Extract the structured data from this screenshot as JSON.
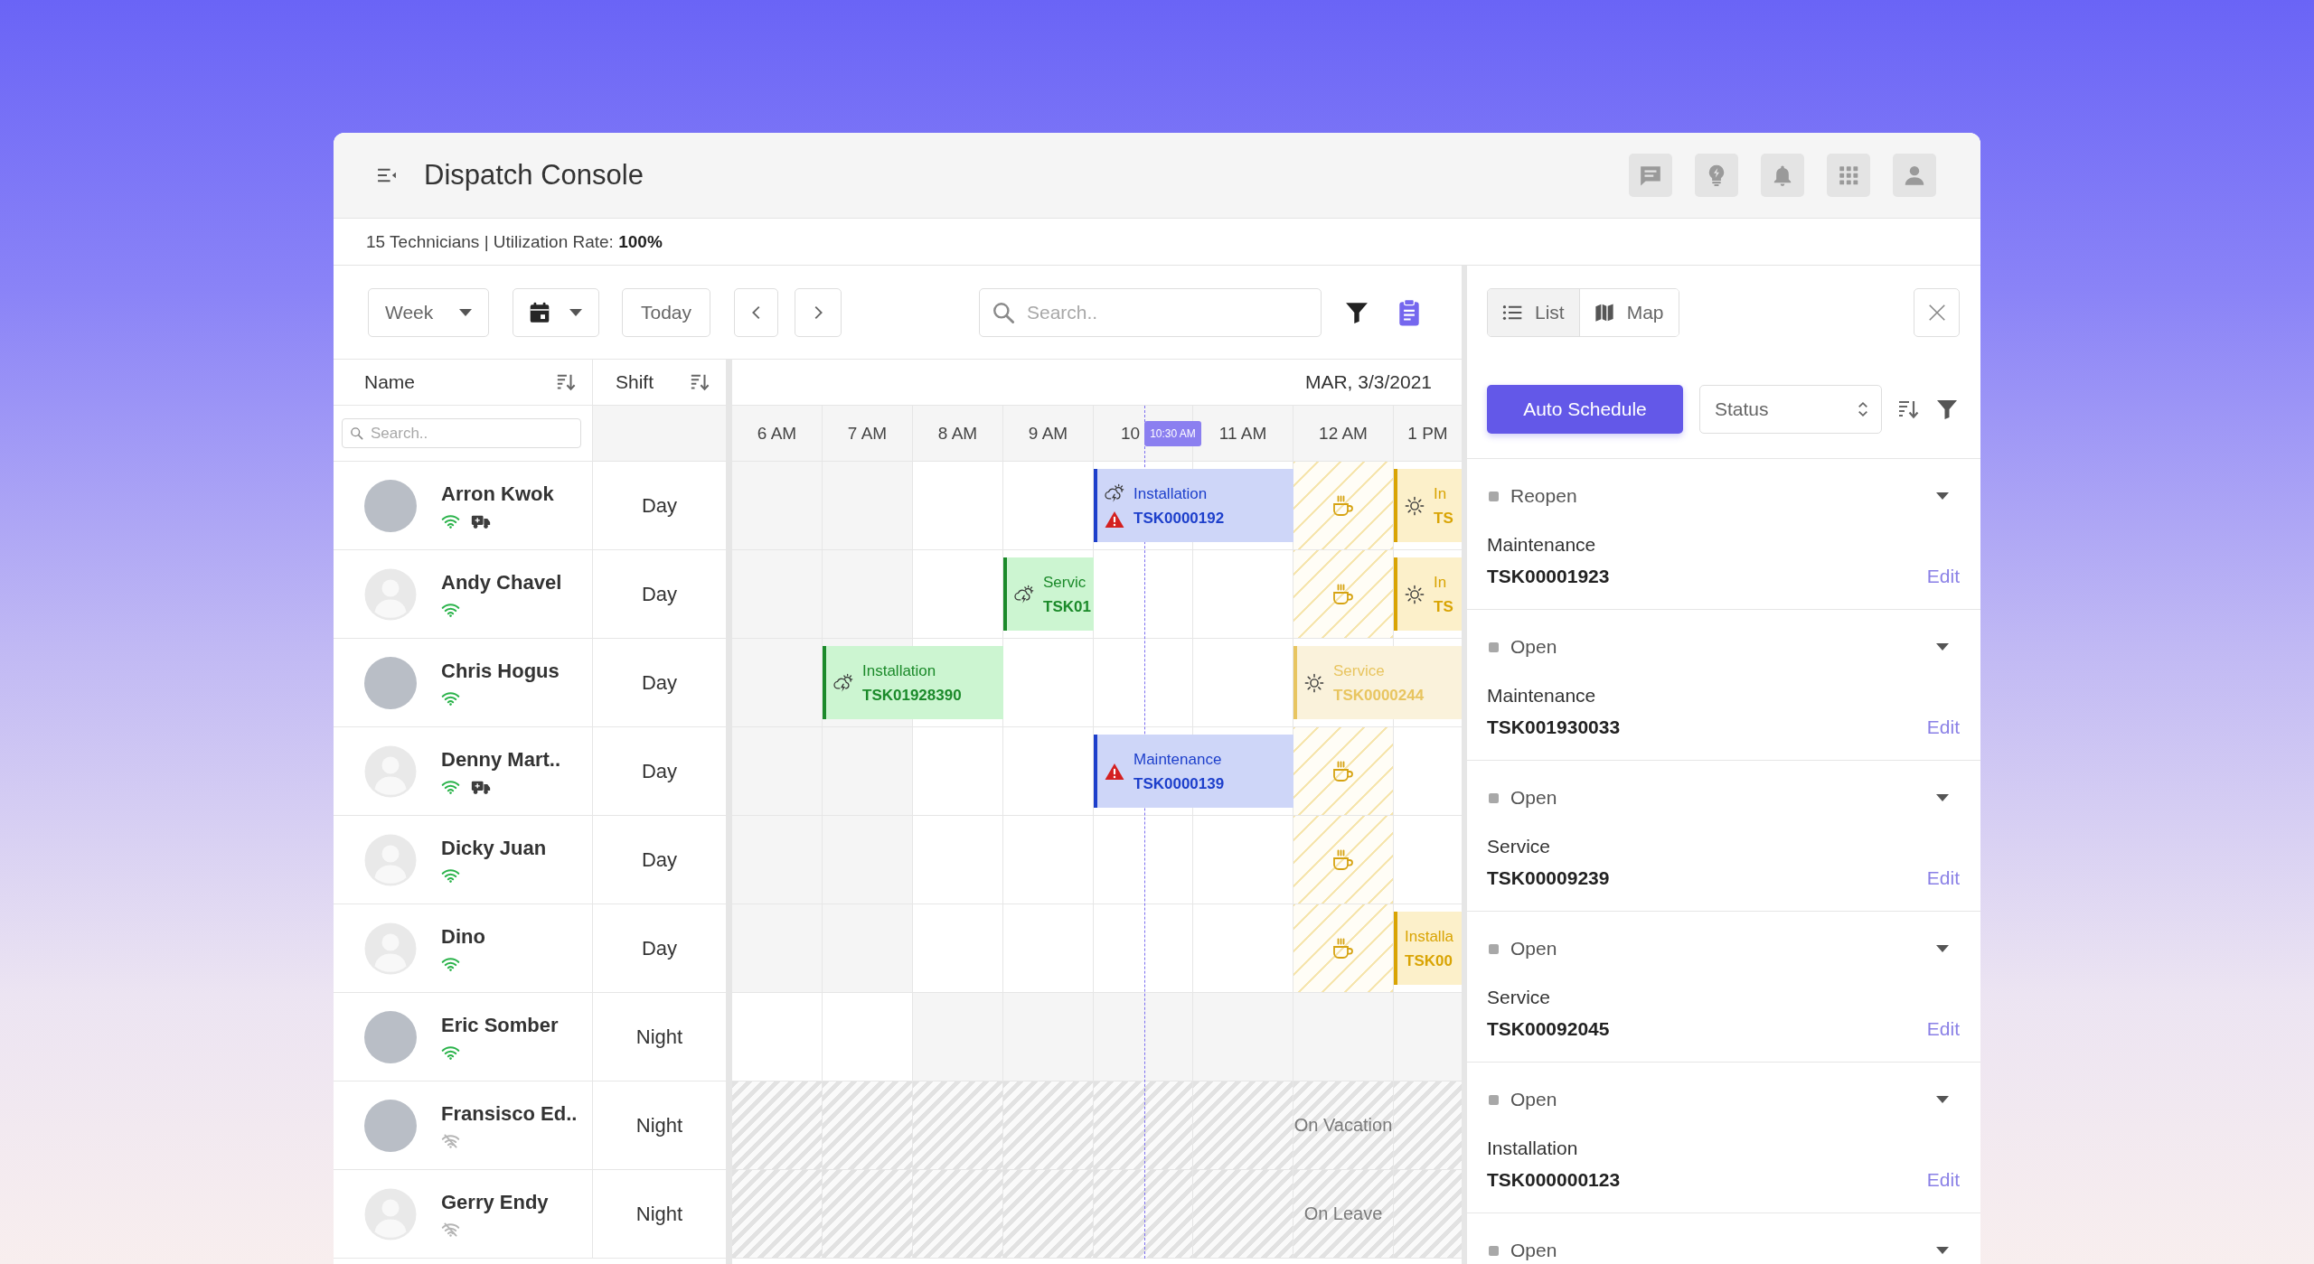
{
  "window": {
    "title": "Dispatch Console"
  },
  "summary": "15 Technicians | Utilization Rate: **100%**",
  "toolbar": {
    "view": "Week",
    "today": "Today",
    "search": {
      "placeholder": "Search.."
    }
  },
  "table": {
    "columns": [
      {
        "label": "Name"
      },
      {
        "label": "Shift"
      }
    ],
    "name_search": {
      "placeholder": "Search.."
    },
    "date": "MAR, 3/3/2021",
    "now_label": "10:30 AM",
    "hours": [
      {
        "label": "6 AM",
        "now": false
      },
      {
        "label": "7 AM",
        "now": false
      },
      {
        "label": "8 AM",
        "now": false
      },
      {
        "label": "9 AM",
        "now": false
      },
      {
        "label": "10",
        "now": true
      },
      {
        "label": "11 AM",
        "now": false
      },
      {
        "label": "12 AM",
        "now": false
      },
      {
        "label": "1 PM",
        "now": false
      }
    ]
  },
  "technicians": [
    {
      "name": "Arron Kwok",
      "photo": true,
      "online": true,
      "vehicle": true,
      "shift": "Day",
      "slots": [
        {
          "kind": "off"
        },
        {
          "kind": "off"
        },
        {
          "kind": "open"
        },
        {
          "kind": "open"
        },
        {
          "kind": "open",
          "task": {
            "type": "Installation",
            "id": "TSK0000192",
            "color": "#1d3fcb",
            "storm": true,
            "sun": false,
            "alert": true
          }
        },
        {
          "kind": "open",
          "continued": true
        },
        {
          "kind": "break"
        },
        {
          "kind": "open",
          "task": {
            "type": "In",
            "id": "TS",
            "color": "#d9a404",
            "storm": false,
            "sun": true,
            "alert": false
          }
        }
      ]
    },
    {
      "name": "Andy Chavel",
      "photo": false,
      "online": true,
      "vehicle": false,
      "shift": "Day",
      "slots": [
        {
          "kind": "off"
        },
        {
          "kind": "off"
        },
        {
          "kind": "open"
        },
        {
          "kind": "open",
          "task": {
            "type": "Servic",
            "id": "TSK01",
            "color": "#1b8a2a",
            "storm": true,
            "sun": false,
            "alert": false
          }
        },
        {
          "kind": "open"
        },
        {
          "kind": "open"
        },
        {
          "kind": "break"
        },
        {
          "kind": "open",
          "task": {
            "type": "In",
            "id": "TS",
            "color": "#d9a404",
            "storm": false,
            "sun": true,
            "alert": false
          }
        }
      ]
    },
    {
      "name": "Chris Hogus",
      "photo": true,
      "online": true,
      "vehicle": false,
      "shift": "Day",
      "slots": [
        {
          "kind": "off"
        },
        {
          "kind": "off",
          "task": {
            "type": "Installation",
            "id": "TSK01928390",
            "color": "#1b8a2a",
            "storm": true,
            "sun": false,
            "alert": false
          }
        },
        {
          "kind": "open",
          "continued": true
        },
        {
          "kind": "open"
        },
        {
          "kind": "open"
        },
        {
          "kind": "open"
        },
        {
          "kind": "open",
          "task": {
            "type": "Service",
            "id": "TSK0000244",
            "color": "#e8c560",
            "storm": false,
            "sun": true,
            "alert": false
          }
        },
        {
          "kind": "open",
          "continued": true
        }
      ]
    },
    {
      "name": "Denny Mart..",
      "photo": false,
      "online": true,
      "vehicle": true,
      "shift": "Day",
      "slots": [
        {
          "kind": "off"
        },
        {
          "kind": "off"
        },
        {
          "kind": "open"
        },
        {
          "kind": "open"
        },
        {
          "kind": "open",
          "task": {
            "type": "Maintenance",
            "id": "TSK0000139",
            "color": "#1d3fcb",
            "storm": false,
            "sun": false,
            "alert": true
          }
        },
        {
          "kind": "open",
          "continued": true
        },
        {
          "kind": "break"
        },
        {
          "kind": "open"
        }
      ]
    },
    {
      "name": "Dicky Juan",
      "photo": false,
      "online": true,
      "vehicle": false,
      "shift": "Day",
      "slots": [
        {
          "kind": "off"
        },
        {
          "kind": "off"
        },
        {
          "kind": "open"
        },
        {
          "kind": "open"
        },
        {
          "kind": "open"
        },
        {
          "kind": "open"
        },
        {
          "kind": "break"
        },
        {
          "kind": "open"
        }
      ]
    },
    {
      "name": "Dino",
      "photo": false,
      "online": true,
      "vehicle": false,
      "shift": "Day",
      "slots": [
        {
          "kind": "off"
        },
        {
          "kind": "off"
        },
        {
          "kind": "open"
        },
        {
          "kind": "open"
        },
        {
          "kind": "open"
        },
        {
          "kind": "open"
        },
        {
          "kind": "break"
        },
        {
          "kind": "open",
          "task": {
            "type": "Installa",
            "id": "TSK00",
            "color": "#d9a404",
            "storm": false,
            "sun": false,
            "alert": false
          }
        }
      ]
    },
    {
      "name": "Eric Somber",
      "photo": true,
      "online": true,
      "vehicle": false,
      "shift": "Night",
      "slots": [
        {
          "kind": "open"
        },
        {
          "kind": "open"
        },
        {
          "kind": "off"
        },
        {
          "kind": "off"
        },
        {
          "kind": "off"
        },
        {
          "kind": "off"
        },
        {
          "kind": "off"
        },
        {
          "kind": "off"
        }
      ]
    },
    {
      "name": "Fransisco Ed..",
      "photo": true,
      "online": false,
      "vehicle": false,
      "shift": "Night",
      "slots": [
        {
          "kind": "away"
        },
        {
          "kind": "away"
        },
        {
          "kind": "away"
        },
        {
          "kind": "away"
        },
        {
          "kind": "away"
        },
        {
          "kind": "away"
        },
        {
          "kind": "away",
          "label": "On Vacation"
        },
        {
          "kind": "away"
        }
      ]
    },
    {
      "name": "Gerry Endy",
      "photo": false,
      "online": false,
      "vehicle": false,
      "shift": "Night",
      "slots": [
        {
          "kind": "away"
        },
        {
          "kind": "away"
        },
        {
          "kind": "away"
        },
        {
          "kind": "away"
        },
        {
          "kind": "away"
        },
        {
          "kind": "away"
        },
        {
          "kind": "away",
          "label": "On Leave"
        },
        {
          "kind": "away"
        }
      ]
    }
  ],
  "panel": {
    "views": [
      {
        "label": "List",
        "selected": true
      },
      {
        "label": "Map",
        "selected": false
      }
    ],
    "auto_schedule": "Auto Schedule",
    "status_filter": "Status",
    "work_orders": [
      {
        "status": "Reopen",
        "type": "Maintenance",
        "id": "TSK00001923",
        "action": "Edit"
      },
      {
        "status": "Open",
        "type": "Maintenance",
        "id": "TSK001930033",
        "action": "Edit"
      },
      {
        "status": "Open",
        "type": "Service",
        "id": "TSK00009239",
        "action": "Edit"
      },
      {
        "status": "Open",
        "type": "Service",
        "id": "TSK00092045",
        "action": "Edit"
      },
      {
        "status": "Open",
        "type": "Installation",
        "id": "TSK000000123",
        "action": "Edit"
      },
      {
        "status": "Open"
      }
    ]
  }
}
